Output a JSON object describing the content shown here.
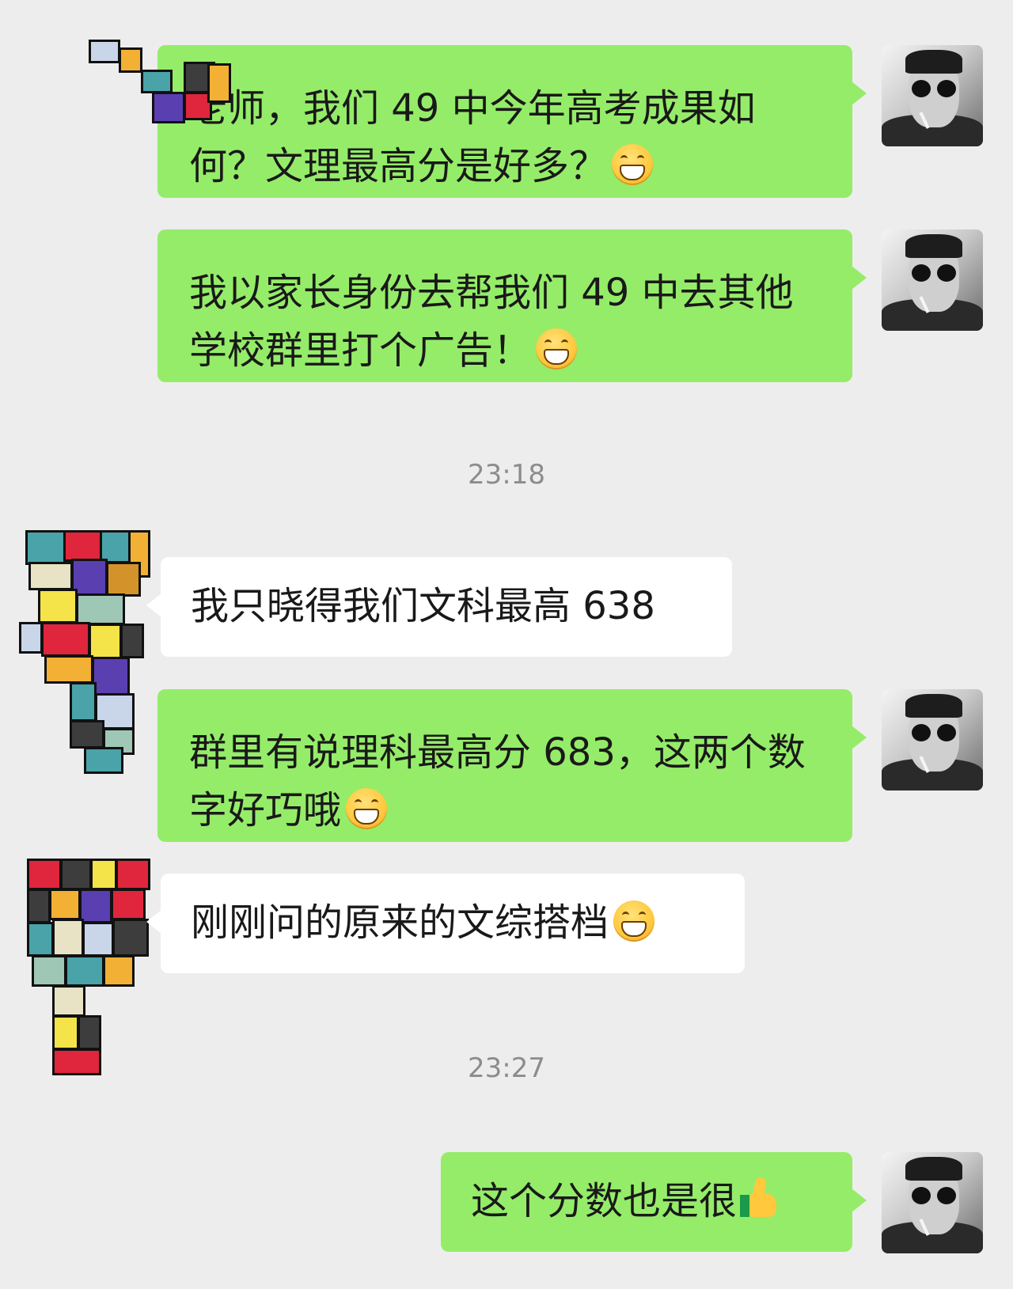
{
  "colors": {
    "background": "#ededed",
    "outgoing_bubble": "#95ec69",
    "incoming_bubble": "#ffffff",
    "timestamp": "#8c8c8c"
  },
  "messages": [
    {
      "side": "out",
      "text": "老师，我们 49 中今年高考成果如何？文理最高分是好多？",
      "emoji": "grinning-face-icon"
    },
    {
      "side": "out",
      "text": "我以家长身份去帮我们 49 中去其他学校群里打个广告！",
      "emoji": "smiling-face-icon"
    },
    {
      "timestamp": "23:18"
    },
    {
      "side": "in",
      "text": "我只晓得我们文科最高 638"
    },
    {
      "side": "out",
      "text": "群里有说理科最高分 683，这两个数字好巧哦",
      "emoji": "grinning-face-icon"
    },
    {
      "side": "in",
      "text": "刚刚问的原来的文综搭档",
      "emoji": "grinning-face-icon"
    },
    {
      "timestamp": "23:27"
    },
    {
      "side": "out",
      "text": "这个分数也是很",
      "emoji": "thumbs-up-icon"
    }
  ]
}
